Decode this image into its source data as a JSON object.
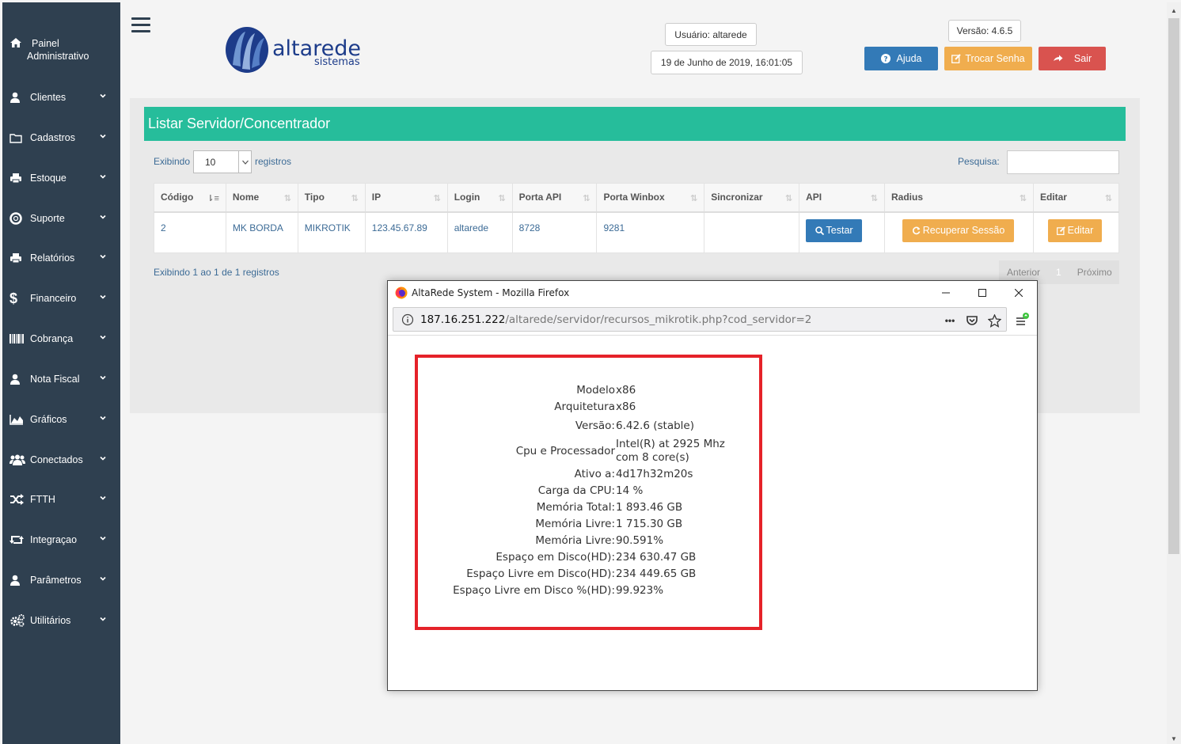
{
  "sidebar": {
    "panel_label_1": "Painel",
    "panel_label_2": "Administrativo",
    "items": [
      {
        "label": "Clientes",
        "icon": "user-icon"
      },
      {
        "label": "Cadastros",
        "icon": "folder-icon"
      },
      {
        "label": "Estoque",
        "icon": "print-icon"
      },
      {
        "label": "Suporte",
        "icon": "lifebuoy-icon"
      },
      {
        "label": "Relatórios",
        "icon": "print-icon"
      },
      {
        "label": "Financeiro",
        "icon": "dollar-icon"
      },
      {
        "label": "Cobrança",
        "icon": "barcode-icon"
      },
      {
        "label": "Nota Fiscal",
        "icon": "user-icon"
      },
      {
        "label": "Gráficos",
        "icon": "area-chart-icon"
      },
      {
        "label": "Conectados",
        "icon": "users-icon"
      },
      {
        "label": "FTTH",
        "icon": "random-icon"
      },
      {
        "label": "Integraçao",
        "icon": "retweet-icon"
      },
      {
        "label": "Parâmetros",
        "icon": "user-icon"
      },
      {
        "label": "Utilitários",
        "icon": "cogs-icon"
      }
    ]
  },
  "header": {
    "logo_text": "altarede",
    "logo_subtext": "sistemas",
    "user": "Usuário: altarede",
    "datetime": "19 de Junho de 2019, 16:01:05",
    "version": "Versão: 4.6.5",
    "help_label": "Ajuda",
    "change_password_label": "Trocar Senha",
    "logout_label": "Sair"
  },
  "panel": {
    "title": "Listar Servidor/Concentrador",
    "length_prefix": "Exibindo",
    "length_value": "10",
    "length_suffix": "registros",
    "search_label": "Pesquisa:",
    "search_value": "",
    "info": "Exibindo 1 ao 1 de 1 registros",
    "pagination": {
      "previous": "Anterior",
      "current": "1",
      "next": "Próximo"
    }
  },
  "table": {
    "columns": [
      "Código",
      "Nome",
      "Tipo",
      "IP",
      "Login",
      "Porta API",
      "Porta Winbox",
      "Sincronizar",
      "API",
      "Radius",
      "Editar"
    ],
    "rows": [
      {
        "codigo": "2",
        "nome": "MK BORDA",
        "tipo": "MIKROTIK",
        "ip": "123.45.67.89",
        "login": "altarede",
        "porta_api": "8728",
        "porta_winbox": "9281",
        "sincronizar": "",
        "api_button": "Testar",
        "radius_button": "Recuperar Sessão",
        "edit_button": "Editar"
      }
    ]
  },
  "popup": {
    "window_title": "AltaRede System - Mozilla Firefox",
    "url_host": "187.16.251.222",
    "url_path": "/altarede/servidor/recursos_mikrotik.php?cod_servidor=2",
    "resources": [
      {
        "key": "Modelo",
        "value": "x86"
      },
      {
        "key": "Arquitetura",
        "value": "x86"
      },
      {
        "key": "Versão:",
        "value": "6.42.6 (stable)"
      },
      {
        "key": "Cpu e Processador",
        "value": "Intel(R) at 2925 Mhz",
        "value2": "com 8 core(s)"
      },
      {
        "key": "Ativo a:",
        "value": "4d17h32m20s"
      },
      {
        "key": "Carga da CPU:",
        "value": "14 %"
      },
      {
        "key": "Memória Total:",
        "value": "1 893.46 GB"
      },
      {
        "key": "Memória Livre:",
        "value": "1 715.30 GB"
      },
      {
        "key": "Memória Livre:",
        "value": "90.591%"
      },
      {
        "key": "Espaço em Disco(HD):",
        "value": "234 630.47 GB"
      },
      {
        "key": "Espaço Livre em Disco(HD):",
        "value": "234 449.65 GB"
      },
      {
        "key": "Espaço Livre em Disco %(HD):",
        "value": "99.923%"
      }
    ]
  },
  "colors": {
    "sidebar": "#2f4050",
    "panel_title": "#26bd9b",
    "primary": "#337ab7",
    "warning": "#f0ad4e",
    "danger": "#d9534f",
    "highlight_box": "#e52229"
  }
}
